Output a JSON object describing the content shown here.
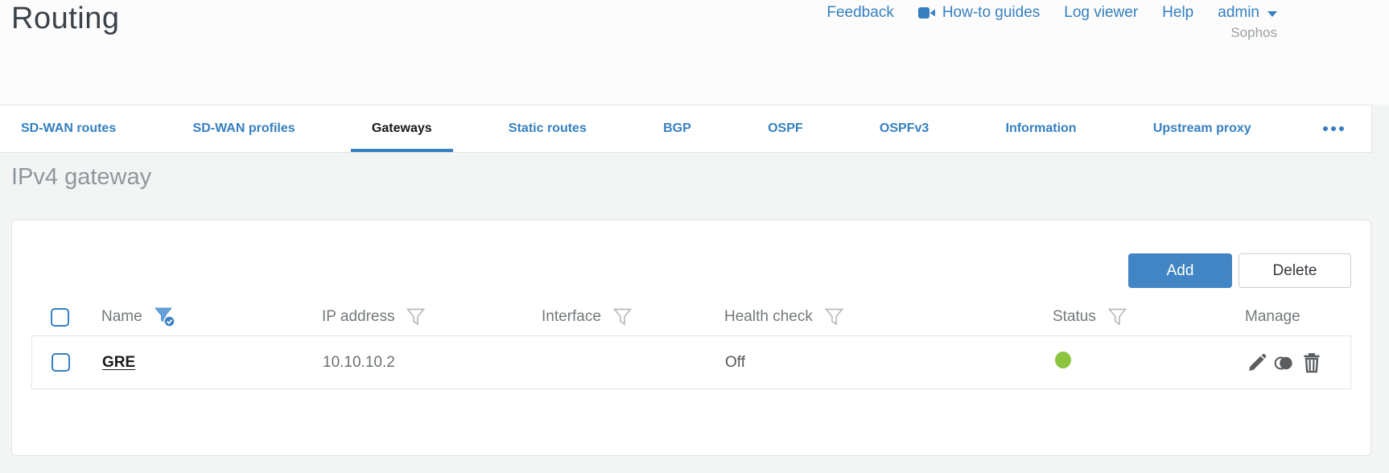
{
  "header": {
    "title": "Routing",
    "links": [
      "Feedback",
      "How-to guides",
      "Log viewer",
      "Help"
    ],
    "user": "admin",
    "brand": "Sophos"
  },
  "tabs": [
    {
      "label": "SD-WAN routes",
      "active": false
    },
    {
      "label": "SD-WAN profiles",
      "active": false
    },
    {
      "label": "Gateways",
      "active": true
    },
    {
      "label": "Static routes",
      "active": false
    },
    {
      "label": "BGP",
      "active": false
    },
    {
      "label": "OSPF",
      "active": false
    },
    {
      "label": "OSPFv3",
      "active": false
    },
    {
      "label": "Information",
      "active": false
    },
    {
      "label": "Upstream proxy",
      "active": false
    }
  ],
  "section": {
    "title": "IPv4 gateway"
  },
  "toolbar": {
    "add_label": "Add",
    "delete_label": "Delete"
  },
  "table": {
    "columns": [
      {
        "label": "",
        "type": "checkbox",
        "filter": "none"
      },
      {
        "label": "Name",
        "filter": "active"
      },
      {
        "label": "IP address",
        "filter": "outline"
      },
      {
        "label": "Interface",
        "filter": "outline"
      },
      {
        "label": "Health check",
        "filter": "outline"
      },
      {
        "label": "Status",
        "filter": "outline"
      },
      {
        "label": "Manage",
        "filter": "none"
      }
    ],
    "rows": [
      {
        "selected": false,
        "name": "GRE",
        "ip_address": "10.10.10.2",
        "interface": "",
        "health_check": "Off",
        "status": "green",
        "manage_actions": [
          "edit",
          "clone",
          "delete"
        ]
      }
    ]
  },
  "colors": {
    "accent_blue": "#3580c1",
    "button_blue": "#4285c4",
    "status_green": "#8bc53f"
  }
}
